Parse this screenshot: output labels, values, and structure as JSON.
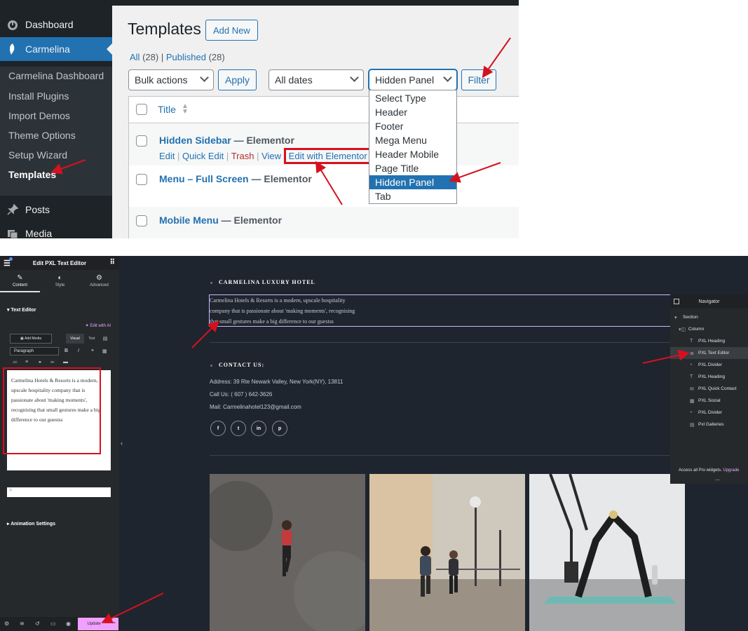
{
  "wp_admin": {
    "menu": [
      {
        "label": "Dashboard",
        "icon": "dashboard-icon"
      },
      {
        "label": "Carmelina",
        "icon": "carmelina-icon"
      },
      {
        "label": "Posts",
        "icon": "pushpin-icon"
      },
      {
        "label": "Media",
        "icon": "media-icon"
      }
    ],
    "submenu": [
      "Carmelina Dashboard",
      "Install Plugins",
      "Import Demos",
      "Theme Options",
      "Setup Wizard",
      "Templates"
    ],
    "page_title": "Templates",
    "add_new": "Add New",
    "filters_links": {
      "all": "All",
      "all_count": "(28)",
      "separator": "|",
      "published": "Published",
      "published_count": "(28)"
    },
    "bulk_actions": "Bulk actions",
    "apply": "Apply",
    "all_dates": "All dates",
    "type_select": "Hidden Panel",
    "filter": "Filter",
    "table": {
      "column_title": "Title",
      "rows": [
        {
          "title": "Hidden Sidebar",
          "type": "— Elementor"
        },
        {
          "title": "Menu – Full Screen",
          "type": "— Elementor"
        },
        {
          "title": "Mobile Menu",
          "type": "— Elementor"
        }
      ],
      "row_actions": {
        "edit": "Edit",
        "quick_edit": "Quick Edit",
        "trash": "Trash",
        "view": "View",
        "edit_with_elementor": "Edit with Elementor",
        "sep": "|"
      }
    },
    "dropdown_options": [
      "Select Type",
      "Header",
      "Footer",
      "Mega Menu",
      "Header Mobile",
      "Page Title",
      "Hidden Panel",
      "Tab"
    ],
    "dropdown_selected": "Hidden Panel"
  },
  "elementor": {
    "panel_title": "Edit PXL Text Editor",
    "tabs": [
      "Content",
      "Style",
      "Advanced"
    ],
    "section_title": "Text Editor",
    "edit_with_ai": "Edit with AI",
    "add_media": "Add Media",
    "mode_visual": "Visual",
    "mode_text": "Text",
    "paragraph": "Paragraph",
    "editor_text": "Carmelina Hotels & Resorts is a modern, upscale hospitality company that is passionate about 'making moments', recognising that small gestures make a big difference to our guestss",
    "status_p": "p",
    "animation_settings": "Animation Settings",
    "update": "Update"
  },
  "canvas": {
    "heading1": "CARMELINA LUXURY HOTEL",
    "text_lines": [
      "Carmelina Hotels & Resorts is a modern, upscale hospitality",
      "company that is passionate about 'making moments', recognising",
      "that small gestures make a big difference to our guestss"
    ],
    "heading2": "CONTACT US:",
    "address": "Address: 39 Rte Newark Valley, New York(NY), 13811",
    "call": "Call Us: ( 607 ) 642-3626",
    "mail": "Mail: Carmelinahotel123@gmail.com",
    "social": [
      "f",
      "t",
      "in",
      "p"
    ]
  },
  "navigator": {
    "title": "Navigator",
    "items": [
      "Section",
      "Column",
      "PXL Heading",
      "PXL Text Editor",
      "PXL Divider",
      "PXL Heading",
      "PXL Quick Contact",
      "PXL Social",
      "PXL Divider",
      "Pxl Galleries"
    ],
    "footer": "Access all Pro widgets.",
    "upgrade": "Upgrade",
    "dots": "..."
  },
  "colors": {
    "wp_admin_dark": "#1d2327",
    "wp_blue": "#2271b1",
    "annotation_red": "#d6111f",
    "elementor_panel": "#26292c",
    "canvas_bg": "#1e252e",
    "update_pink": "#f2a0ff"
  }
}
